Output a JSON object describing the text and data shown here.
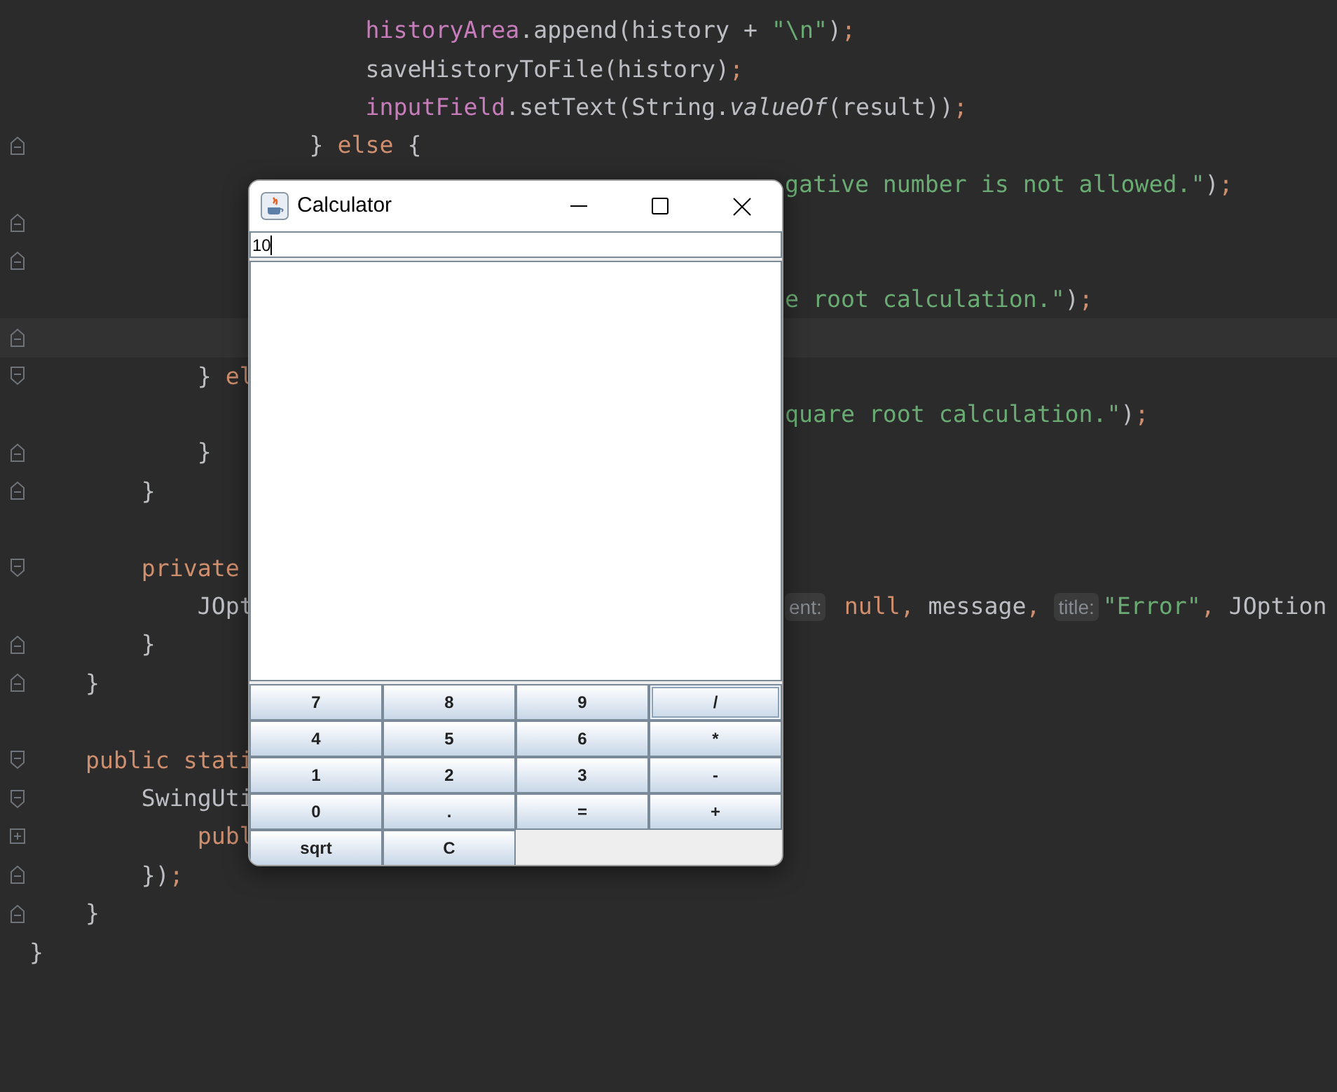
{
  "editor": {
    "lines": [
      {
        "kind": "code",
        "tokens": [
          {
            "text": "                        historyArea",
            "kind": "field"
          },
          {
            "text": ".append(history + ",
            "kind": "plain"
          },
          {
            "text": "\"\\n\"",
            "kind": "string"
          },
          {
            "text": ")",
            "kind": "plain"
          },
          {
            "text": ";",
            "kind": "keyword"
          }
        ]
      },
      {
        "kind": "code",
        "tokens": [
          {
            "text": "                        saveHistoryToFile(history)",
            "kind": "plain"
          },
          {
            "text": ";",
            "kind": "keyword"
          }
        ]
      },
      {
        "kind": "code",
        "tokens": [
          {
            "text": "                        inputField",
            "kind": "field"
          },
          {
            "text": ".setText(String.",
            "kind": "plain"
          },
          {
            "text": "valueOf",
            "kind": "italic"
          },
          {
            "text": "(result))",
            "kind": "plain"
          },
          {
            "text": ";",
            "kind": "keyword"
          }
        ]
      },
      {
        "kind": "code",
        "fold_marker": {
          "kind": "end"
        },
        "tokens": [
          {
            "text": "                    } ",
            "kind": "plain"
          },
          {
            "text": "else",
            "kind": "keyword"
          },
          {
            "text": " {",
            "kind": "plain"
          }
        ]
      },
      {
        "kind": "code",
        "right": [
          {
            "text": "gative number is not allowed.\"",
            "kind": "string"
          },
          {
            "text": ")",
            "kind": "plain"
          },
          {
            "text": ";",
            "kind": "keyword"
          }
        ]
      },
      {
        "kind": "blank",
        "fold_marker": {
          "kind": "end"
        }
      },
      {
        "kind": "blank",
        "fold_marker": {
          "kind": "end"
        }
      },
      {
        "kind": "code",
        "right": [
          {
            "text": "e root calculation.\"",
            "kind": "string"
          },
          {
            "text": ")",
            "kind": "plain"
          },
          {
            "text": ";",
            "kind": "keyword"
          }
        ]
      },
      {
        "kind": "current",
        "fold_marker": {
          "kind": "end"
        }
      },
      {
        "kind": "code",
        "fold_marker": {
          "kind": "start"
        },
        "tokens": [
          {
            "text": "            } ",
            "kind": "plain"
          },
          {
            "text": "el",
            "kind": "keyword"
          }
        ]
      },
      {
        "kind": "code",
        "right": [
          {
            "text": "quare root calculation.\"",
            "kind": "string"
          },
          {
            "text": ")",
            "kind": "plain"
          },
          {
            "text": ";",
            "kind": "keyword"
          }
        ]
      },
      {
        "kind": "code",
        "fold_marker": {
          "kind": "end"
        },
        "tokens": [
          {
            "text": "            }",
            "kind": "plain"
          }
        ]
      },
      {
        "kind": "code",
        "fold_marker": {
          "kind": "end"
        },
        "tokens": [
          {
            "text": "        }",
            "kind": "plain"
          }
        ]
      },
      {
        "kind": "blank"
      },
      {
        "kind": "code",
        "fold_marker": {
          "kind": "start"
        },
        "tokens": [
          {
            "text": "        private",
            "kind": "keyword"
          }
        ]
      },
      {
        "kind": "code",
        "tokens": [
          {
            "text": "            JOpt",
            "kind": "plain"
          }
        ],
        "right": [
          {
            "text": "ent:",
            "kind": "hint"
          },
          {
            "text": " null",
            "kind": "keyword"
          },
          {
            "text": ", ",
            "kind": "keyword"
          },
          {
            "text": "message",
            "kind": "plain"
          },
          {
            "text": ", ",
            "kind": "keyword"
          },
          {
            "text": "title:",
            "kind": "hint"
          },
          {
            "text": "\"Error\"",
            "kind": "string"
          },
          {
            "text": ", ",
            "kind": "keyword"
          },
          {
            "text": "JOption",
            "kind": "plain"
          }
        ]
      },
      {
        "kind": "code",
        "fold_marker": {
          "kind": "end"
        },
        "tokens": [
          {
            "text": "        }",
            "kind": "plain"
          }
        ]
      },
      {
        "kind": "code",
        "fold_marker": {
          "kind": "end"
        },
        "tokens": [
          {
            "text": "    }",
            "kind": "plain"
          }
        ]
      },
      {
        "kind": "blank"
      },
      {
        "kind": "code",
        "fold_marker": {
          "kind": "start"
        },
        "tokens": [
          {
            "text": "    public stati",
            "kind": "keyword"
          }
        ]
      },
      {
        "kind": "code",
        "fold_marker": {
          "kind": "start"
        },
        "tokens": [
          {
            "text": "        SwingUti",
            "kind": "plain"
          }
        ]
      },
      {
        "kind": "code",
        "fold_marker": {
          "kind": "collapsed"
        },
        "tokens": [
          {
            "text": "            publ",
            "kind": "keyword"
          }
        ]
      },
      {
        "kind": "code",
        "fold_marker": {
          "kind": "end"
        },
        "tokens": [
          {
            "text": "        })",
            "kind": "plain"
          },
          {
            "text": ";",
            "kind": "keyword"
          }
        ]
      },
      {
        "kind": "code",
        "fold_marker": {
          "kind": "end"
        },
        "tokens": [
          {
            "text": "    }",
            "kind": "plain"
          }
        ]
      },
      {
        "kind": "code",
        "tokens": [
          {
            "text": "}",
            "kind": "plain"
          }
        ]
      }
    ]
  },
  "calculator": {
    "title": "Calculator",
    "input": {
      "value": "10"
    },
    "buttons": [
      {
        "label": "7",
        "focused": false
      },
      {
        "label": "8",
        "focused": false
      },
      {
        "label": "9",
        "focused": false
      },
      {
        "label": "/",
        "focused": true
      },
      {
        "label": "4",
        "focused": false
      },
      {
        "label": "5",
        "focused": false
      },
      {
        "label": "6",
        "focused": false
      },
      {
        "label": "*",
        "focused": false
      },
      {
        "label": "1",
        "focused": false
      },
      {
        "label": "2",
        "focused": false
      },
      {
        "label": "3",
        "focused": false
      },
      {
        "label": "-",
        "focused": false
      },
      {
        "label": "0",
        "focused": false
      },
      {
        "label": ".",
        "focused": false
      },
      {
        "label": "=",
        "focused": false
      },
      {
        "label": "+",
        "focused": false
      },
      {
        "label": "sqrt",
        "focused": false
      },
      {
        "label": "C",
        "focused": false
      }
    ]
  }
}
